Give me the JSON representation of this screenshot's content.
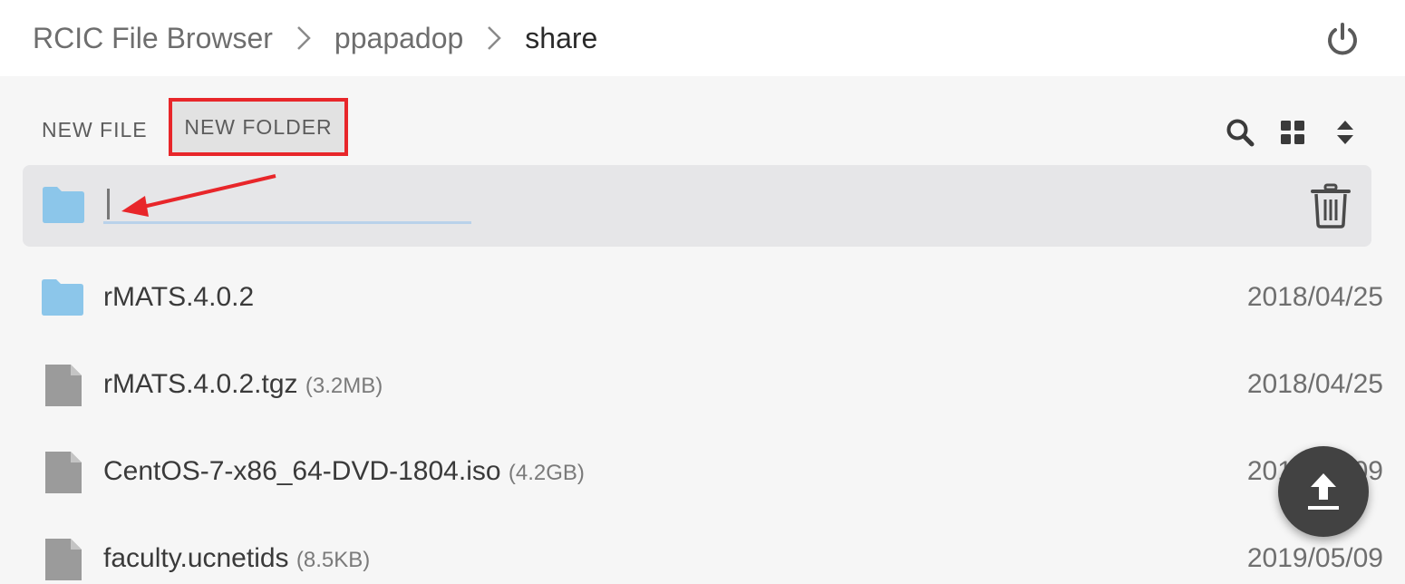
{
  "breadcrumb": [
    "RCIC File Browser",
    "ppapadop",
    "share"
  ],
  "toolbar": {
    "new_file_label": "NEW FILE",
    "new_folder_label": "NEW FOLDER"
  },
  "new_folder": {
    "name_value": ""
  },
  "files": [
    {
      "name": "rMATS.4.0.2",
      "size": "",
      "date": "2018/04/25",
      "type": "folder"
    },
    {
      "name": "rMATS.4.0.2.tgz",
      "size": "(3.2MB)",
      "date": "2018/04/25",
      "type": "file"
    },
    {
      "name": "CentOS-7-x86_64-DVD-1804.iso",
      "size": "(4.2GB)",
      "date": "2019/05/09",
      "type": "file"
    },
    {
      "name": "faculty.ucnetids",
      "size": "(8.5KB)",
      "date": "2019/05/09",
      "type": "file"
    }
  ],
  "icons": {
    "logout": "power-icon",
    "search": "search-icon",
    "view": "grid-view-icon",
    "sort": "sort-icon",
    "delete": "trash-icon",
    "upload": "upload-icon"
  },
  "colors": {
    "folder": "#8cc6ea",
    "file": "#9b9b9b",
    "highlight": "#e8262a",
    "fab": "#424242"
  }
}
